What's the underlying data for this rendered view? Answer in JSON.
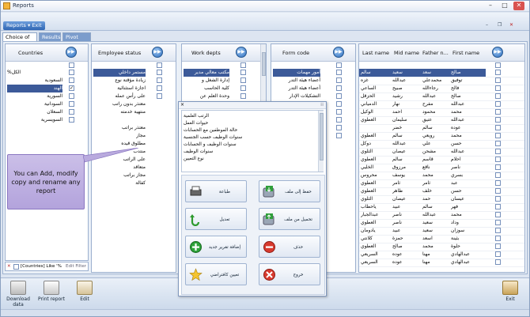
{
  "window": {
    "title": "Reports"
  },
  "ribbon": {
    "menu_label": "Reports ▾ Exit"
  },
  "tabs": [
    "Choice of data",
    "Results",
    "Pivot table"
  ],
  "columns": {
    "countries": {
      "header": "Countries",
      "items": [
        "الكل%",
        "السعودية",
        "الهند",
        "السورية",
        "السودانية",
        "السعلان",
        "السويسرية"
      ],
      "selected_index": 2,
      "checked_index": 2
    },
    "employee_status": {
      "header": "Employee status",
      "items": [
        "مستمر داخلي",
        "زيادة مؤقتة نوع",
        "اجازة استثنائية",
        "على رأس عمله",
        "معتذر بدون راتب",
        "منتهية خدمته",
        "",
        "معتذر براتب",
        "مجاز",
        "مطلوق قيده",
        "منتدب",
        "على الراتب",
        "متعاقد",
        "مجاز براتب",
        "كفالة"
      ]
    },
    "work_depts": {
      "header": "Work depts",
      "items": [
        "مكتب معالي مدير",
        "إدارة الشغل و",
        "كلية الحاسب",
        "وحدة العلم عن"
      ]
    },
    "form_code": {
      "header": "Form code",
      "items": [
        "أمور مهمات",
        "أعضاء هيئة التدر",
        "أعضاء هيئة التدر",
        "التشكيلات الإدار"
      ]
    },
    "names": {
      "headers": [
        "Last name",
        "Mid name",
        "Father n...",
        "First name"
      ],
      "rows": [
        [
          "سالم",
          "سعيد",
          "سعد",
          "صالح"
        ],
        [
          "غزه",
          "عبدالله",
          "محمدعلي",
          "توفيق"
        ],
        [
          "الساعي",
          "صبيح",
          "رجاءالله",
          "فالح"
        ],
        [
          "الحزقل",
          "رشيد",
          "عبدالله",
          "صالح"
        ],
        [
          "الدمياني",
          "نهار",
          "مفرح",
          "عبدالله"
        ],
        [
          "الوكيل",
          "احمد",
          "محمود",
          "محمد"
        ],
        [
          "العطوي",
          "سليمان",
          "عتيق",
          "عبدالله"
        ],
        [
          "",
          "خضر",
          "سالم",
          "عوده"
        ],
        [
          "العطوي",
          "سالم",
          "رويعي",
          "محمد"
        ],
        [
          "دوكل",
          "عبدالله",
          "علي",
          "حسن"
        ],
        [
          "الثلوي",
          "عيصان",
          "مشحن",
          "عبدالله"
        ],
        [
          "العطوي",
          "سالم",
          "قاسم",
          "احلام"
        ],
        [
          "الخليي",
          "مرزوق",
          "ناقع",
          "ناصر"
        ],
        [
          "محروس",
          "يوسف",
          "محمد",
          "بسري"
        ],
        [
          "العطوي",
          "ثامر",
          "ثامر",
          "عبد"
        ],
        [
          "العطوي",
          "طاهر",
          "خلف",
          "حسن"
        ],
        [
          "الثلوي",
          "عيصان",
          "حمد",
          "عيسان"
        ],
        [
          "ياحطاب",
          "عبيد",
          "سالم",
          "فهر"
        ],
        [
          "عبدالجبار",
          "ناصر",
          "عبدالله",
          "محمد"
        ],
        [
          "العطوي",
          "ناصر",
          "سعيد",
          "وداد"
        ],
        [
          "يادومان",
          "عبيد",
          "سعيد",
          "سوزان"
        ],
        [
          "كلانتي",
          "حمزة",
          "اسعد",
          "بثينة"
        ],
        [
          "العطوي",
          "صالح",
          "محمد",
          "حلوة"
        ],
        [
          "السريعي",
          "عوده",
          "مهنا",
          "عبدالهادي"
        ],
        [
          "السريعي",
          "عوده",
          "مهنا",
          "عبدالهادي"
        ]
      ]
    }
  },
  "filter": {
    "text": "[Countries] Like '%الـ",
    "edit_label": "Edit Filter"
  },
  "popup": {
    "list_items": [
      "الرتب العلمية",
      "حيوات العمل",
      "حالة الموظفين مع الحسابات",
      "سنوات الوظيف حسب الجنسية",
      "سنوات الوظيف و الحسابات",
      "سنوات الوظيف",
      "نوع التعيين"
    ],
    "buttons": {
      "print": "طباعة",
      "save_file": "حفظ إلى ملف",
      "edit": "تعديل",
      "load_file": "تحميل من ملف",
      "new_report": "إضافة تقرير جديد",
      "delete": "حذف",
      "set_default": "تعيين كافتراضي",
      "exit": "خروج"
    }
  },
  "callout": {
    "text": "You can Add, modify copy and rename any report"
  },
  "bottom": {
    "download_label": "Download data",
    "print_label": "Print report",
    "edit_label": "Edit",
    "exit_label": "Exit"
  }
}
